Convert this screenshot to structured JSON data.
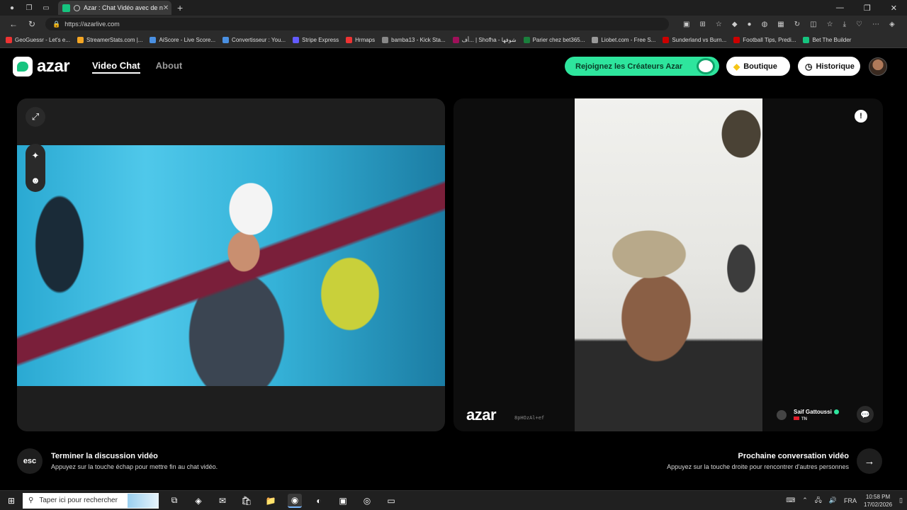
{
  "browser": {
    "tab_title": "Azar : Chat Vidéo avec de n",
    "url": "https://azarlive.com",
    "bookmarks": [
      {
        "label": "GeoGuessr - Let's e...",
        "color": "#e33"
      },
      {
        "label": "StreamerStats.com |...",
        "color": "#f5a623"
      },
      {
        "label": "AiScore - Live Score...",
        "color": "#4a90e2"
      },
      {
        "label": "Convertisseur : You...",
        "color": "#4a90e2"
      },
      {
        "label": "Stripe Express",
        "color": "#635bff"
      },
      {
        "label": "Hrmaps",
        "color": "#e33"
      },
      {
        "label": "bamba13 - Kick Sta...",
        "color": "#888"
      },
      {
        "label": "أف... | Shofha - شوفها",
        "color": "#a0105a"
      },
      {
        "label": "Parier chez bet365...",
        "color": "#1a7f3c"
      },
      {
        "label": "Liobet.com - Free S...",
        "color": "#999"
      },
      {
        "label": "Sunderland vs Burn...",
        "color": "#c00"
      },
      {
        "label": "Football Tips, Predi...",
        "color": "#c00"
      },
      {
        "label": "Bet The Builder",
        "color": "#16c47f"
      }
    ]
  },
  "header": {
    "logo_text": "azar",
    "nav": {
      "video_chat": "Video Chat",
      "about": "About"
    },
    "creators_btn": "Rejoignez les Créateurs Azar",
    "shop_btn": "Boutique",
    "history_btn": "Historique"
  },
  "remote": {
    "watermark": "azar",
    "session_code": "8pHOzAl+ef",
    "user_name": "Saif Gattoussi",
    "country": "TN"
  },
  "actions": {
    "esc_key": "esc",
    "end_title": "Terminer la discussion vidéo",
    "end_hint": "Appuyez sur la touche échap pour mettre fin au chat vidéo.",
    "next_title": "Prochaine conversation vidéo",
    "next_hint": "Appuyez sur la touche droite pour rencontrer d'autres personnes"
  },
  "taskbar": {
    "search_placeholder": "Taper ici pour rechercher",
    "lang": "FRA",
    "time": "10:58 PM",
    "date": "17/02/2026"
  },
  "colors": {
    "accent": "#2ee59d",
    "brand": "#16c47f",
    "panel": "#1e1e1e"
  }
}
